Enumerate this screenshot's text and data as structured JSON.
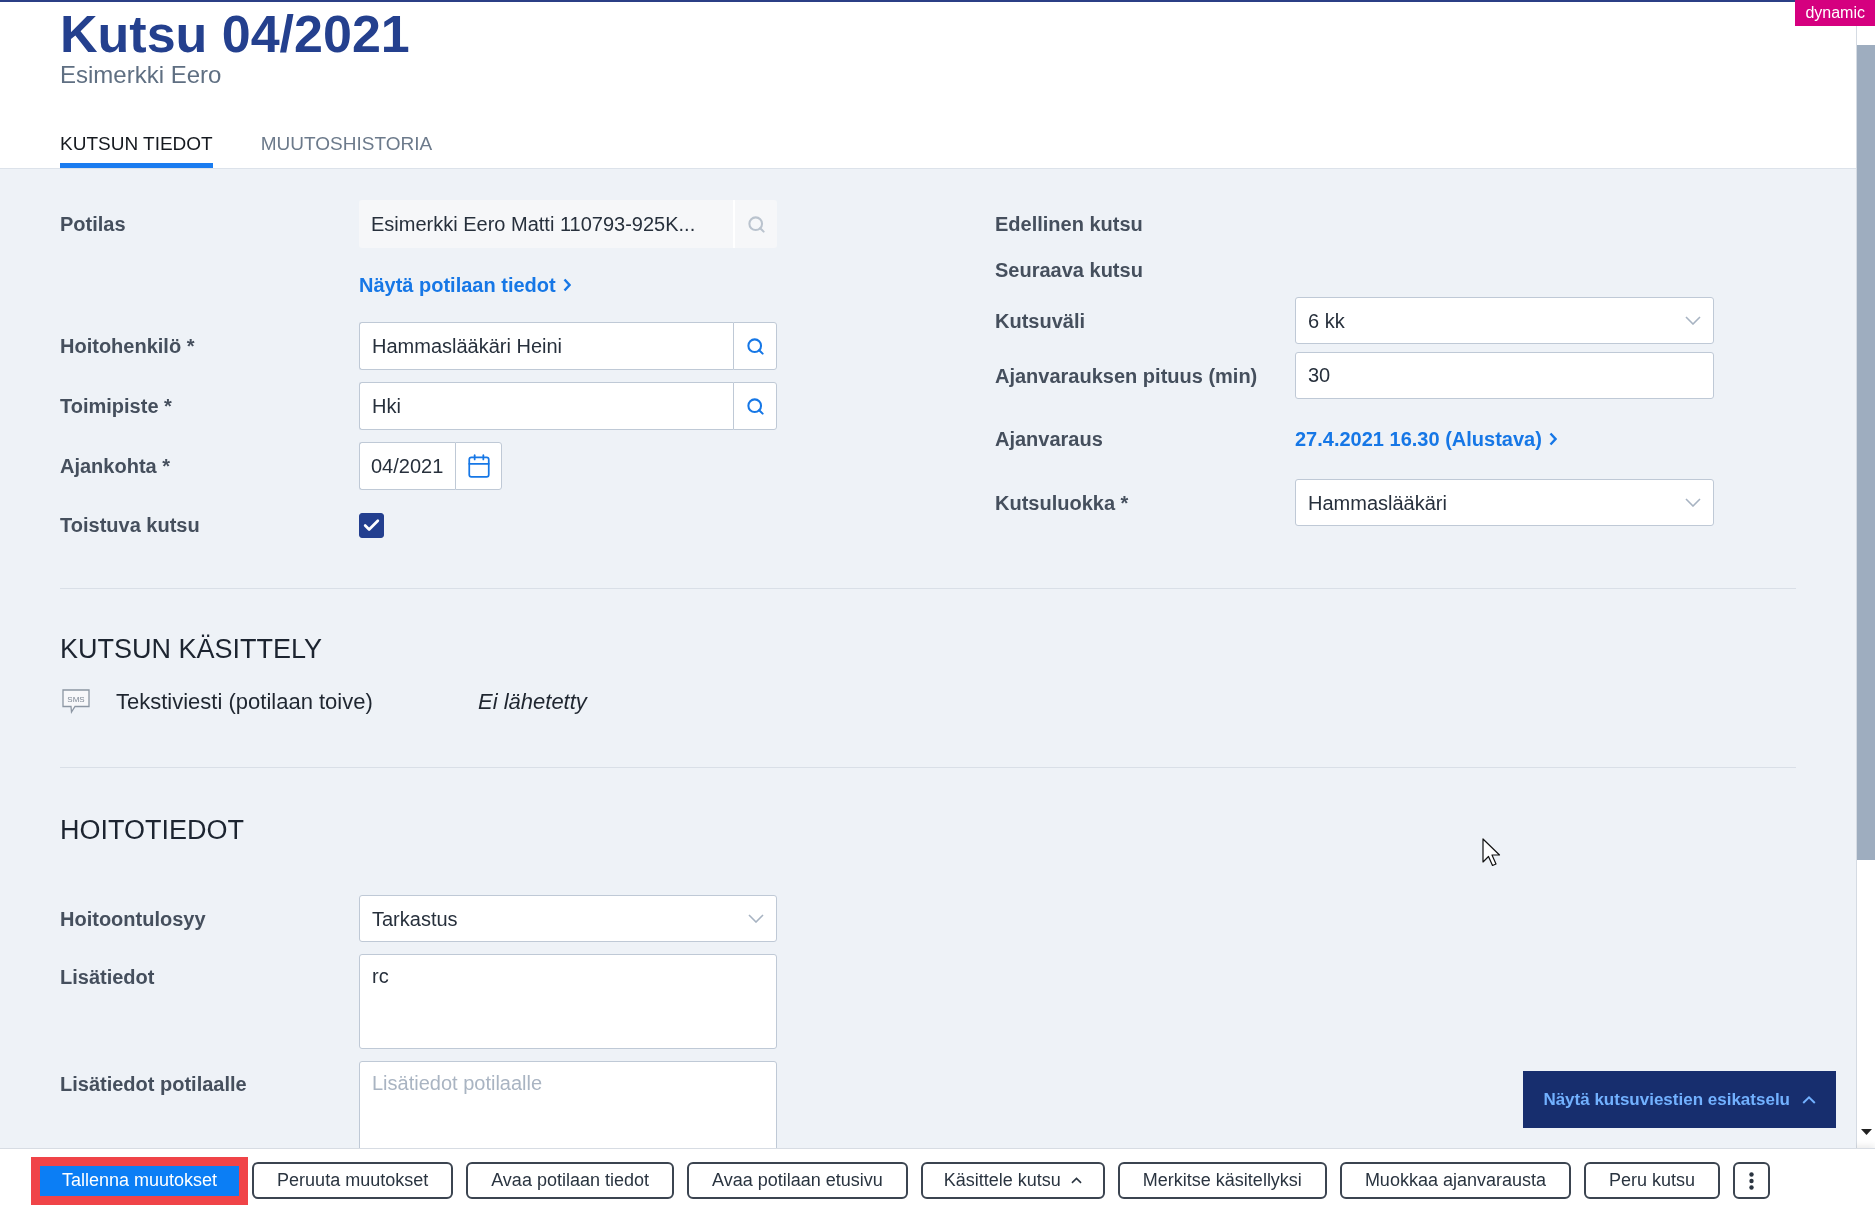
{
  "header": {
    "title": "Kutsu 04/2021",
    "subtitle": "Esimerkki Eero",
    "badge": "dynamic"
  },
  "tabs": [
    {
      "label": "KUTSUN TIEDOT",
      "selected": true
    },
    {
      "label": "MUUTOSHISTORIA",
      "selected": false
    }
  ],
  "form_left": [
    {
      "kind": "lookup",
      "label": "Potilas",
      "value": "Esimerkki Eero Matti 110793-925K...",
      "disabled": true
    },
    {
      "kind": "link",
      "link": "Näytä potilaan tiedot"
    },
    {
      "kind": "lookup",
      "label": "Hoitohenkilö *",
      "value": "Hammaslääkäri Heini",
      "disabled": false
    },
    {
      "kind": "lookup",
      "label": "Toimipiste *",
      "value": "Hki",
      "disabled": false
    },
    {
      "kind": "date",
      "label": "Ajankohta *",
      "value": "04/2021"
    },
    {
      "kind": "checkbox",
      "label": "Toistuva kutsu",
      "checked": true
    }
  ],
  "form_right": [
    {
      "kind": "static",
      "label": "Edellinen kutsu"
    },
    {
      "kind": "static",
      "label": "Seuraava kutsu"
    },
    {
      "kind": "select",
      "label": "Kutsuväli",
      "value": "6 kk"
    },
    {
      "kind": "input",
      "label": "Ajanvarauksen pituus (min)",
      "value": "30"
    },
    {
      "kind": "link",
      "label": "Ajanvaraus",
      "link": "27.4.2021 16.30 (Alustava)"
    },
    {
      "kind": "select",
      "label": "Kutsuluokka *",
      "value": "Hammaslääkäri"
    }
  ],
  "processing": {
    "heading": "KUTSUN KÄSITTELY",
    "items": [
      {
        "icon_text": "SMS",
        "channel": "Tekstiviesti (potilaan toive)",
        "status": "Ei lähetetty"
      }
    ]
  },
  "care": {
    "heading": "HOITOTIEDOT",
    "fields": [
      {
        "kind": "select",
        "label": "Hoitoontulosyy",
        "value": "Tarkastus"
      },
      {
        "kind": "textarea",
        "label": "Lisätiedot",
        "value": "rc"
      },
      {
        "kind": "textarea",
        "label": "Lisätiedot potilaalle",
        "placeholder": "Lisätiedot potilaalle"
      }
    ]
  },
  "preview_button": {
    "label": "Näytä kutsuviestien esikatselu"
  },
  "actions": [
    {
      "kind": "primary",
      "label": "Tallenna muutokset",
      "highlighted": true
    },
    {
      "kind": "secondary",
      "label": "Peruuta muutokset",
      "highlighted": false
    },
    {
      "kind": "secondary",
      "label": "Avaa potilaan tiedot",
      "highlighted": false
    },
    {
      "kind": "secondary",
      "label": "Avaa potilaan etusivu",
      "highlighted": false
    },
    {
      "kind": "menu",
      "label": "Käsittele kutsu",
      "highlighted": false
    },
    {
      "kind": "secondary",
      "label": "Merkitse käsitellyksi",
      "highlighted": false
    },
    {
      "kind": "secondary",
      "label": "Muokkaa ajanvarausta",
      "highlighted": false
    },
    {
      "kind": "secondary",
      "label": "Peru kutsu",
      "highlighted": false
    },
    {
      "kind": "more",
      "highlighted": false
    }
  ]
}
